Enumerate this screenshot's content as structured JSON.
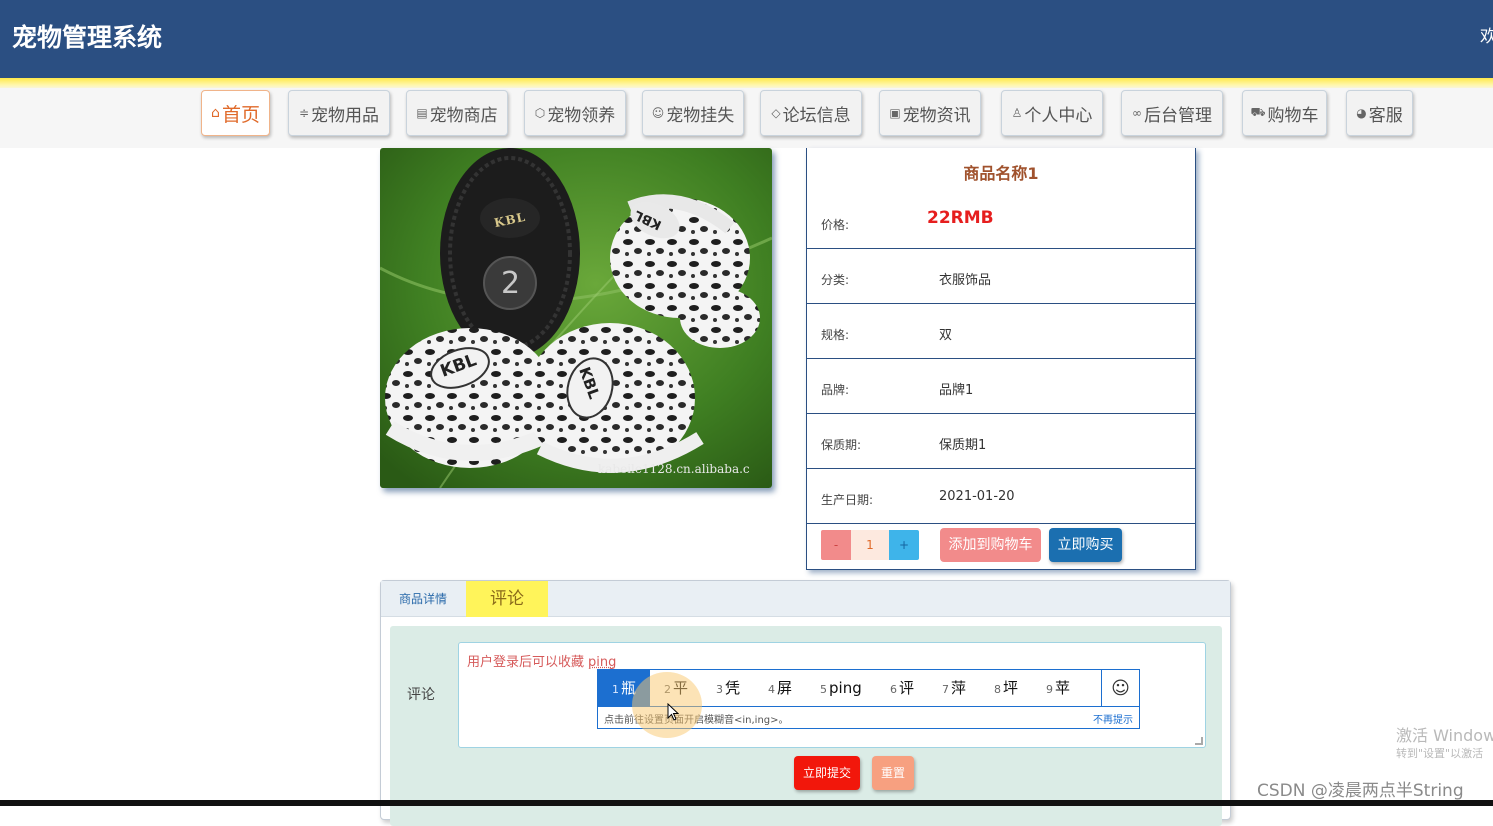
{
  "header": {
    "title": "宠物管理系统",
    "welcome": "欢"
  },
  "nav": {
    "items": [
      {
        "label": "首页",
        "icon": "home-icon",
        "glyph": "⌂"
      },
      {
        "label": "宠物用品",
        "icon": "sliders-icon",
        "glyph": "≑"
      },
      {
        "label": "宠物商店",
        "icon": "calendar-icon",
        "glyph": "▤"
      },
      {
        "label": "宠物领养",
        "icon": "cube-icon",
        "glyph": "⬡"
      },
      {
        "label": "宠物挂失",
        "icon": "smile-icon",
        "glyph": "☺"
      },
      {
        "label": "论坛信息",
        "icon": "tag-icon",
        "glyph": "◇"
      },
      {
        "label": "宠物资讯",
        "icon": "news-icon",
        "glyph": "▣"
      },
      {
        "label": "个人中心",
        "icon": "user-icon",
        "glyph": "♙"
      },
      {
        "label": "后台管理",
        "icon": "link-icon",
        "glyph": "∞"
      },
      {
        "label": "购物车",
        "icon": "cart-icon",
        "glyph": "⛟"
      },
      {
        "label": "客服",
        "icon": "chat-icon",
        "glyph": "◕"
      }
    ]
  },
  "product": {
    "image_caption": "kabeile1128.cn.alibaba.c",
    "brand_text": "KBL",
    "size_text": "2",
    "name": "商品名称1",
    "rows": [
      {
        "label": "价格:",
        "value": "22RMB"
      },
      {
        "label": "分类:",
        "value": "衣服饰品"
      },
      {
        "label": "规格:",
        "value": "双"
      },
      {
        "label": "品牌:",
        "value": "品牌1"
      },
      {
        "label": "保质期:",
        "value": "保质期1"
      },
      {
        "label": "生产日期:",
        "value": "2021-01-20"
      }
    ],
    "qty_minus": "-",
    "qty_value": "1",
    "qty_plus": "+",
    "add_to_cart": "添加到购物车",
    "buy_now": "立即购买"
  },
  "tabs": {
    "details": "商品详情",
    "comment": "评论"
  },
  "comment_form": {
    "label": "评论",
    "placeholder": "用户登录后可以收藏",
    "typed": "ping",
    "submit": "立即提交",
    "reset": "重置"
  },
  "ime": {
    "candidates": [
      {
        "n": "1",
        "text": "瓶"
      },
      {
        "n": "2",
        "text": "平"
      },
      {
        "n": "3",
        "text": "凭"
      },
      {
        "n": "4",
        "text": "屏"
      },
      {
        "n": "5",
        "text": "ping"
      },
      {
        "n": "6",
        "text": "评"
      },
      {
        "n": "7",
        "text": "萍"
      },
      {
        "n": "8",
        "text": "坪"
      },
      {
        "n": "9",
        "text": "苹"
      }
    ],
    "emoji": "☺",
    "hint": "点击前往设置页面开启模糊音<in,ing>。",
    "dismiss": "不再提示"
  },
  "overlay": {
    "win_activate": "激活 Window",
    "win_activate_sub": "转到\"设置\"以激活",
    "csdn": "CSDN @凌晨两点半String"
  }
}
